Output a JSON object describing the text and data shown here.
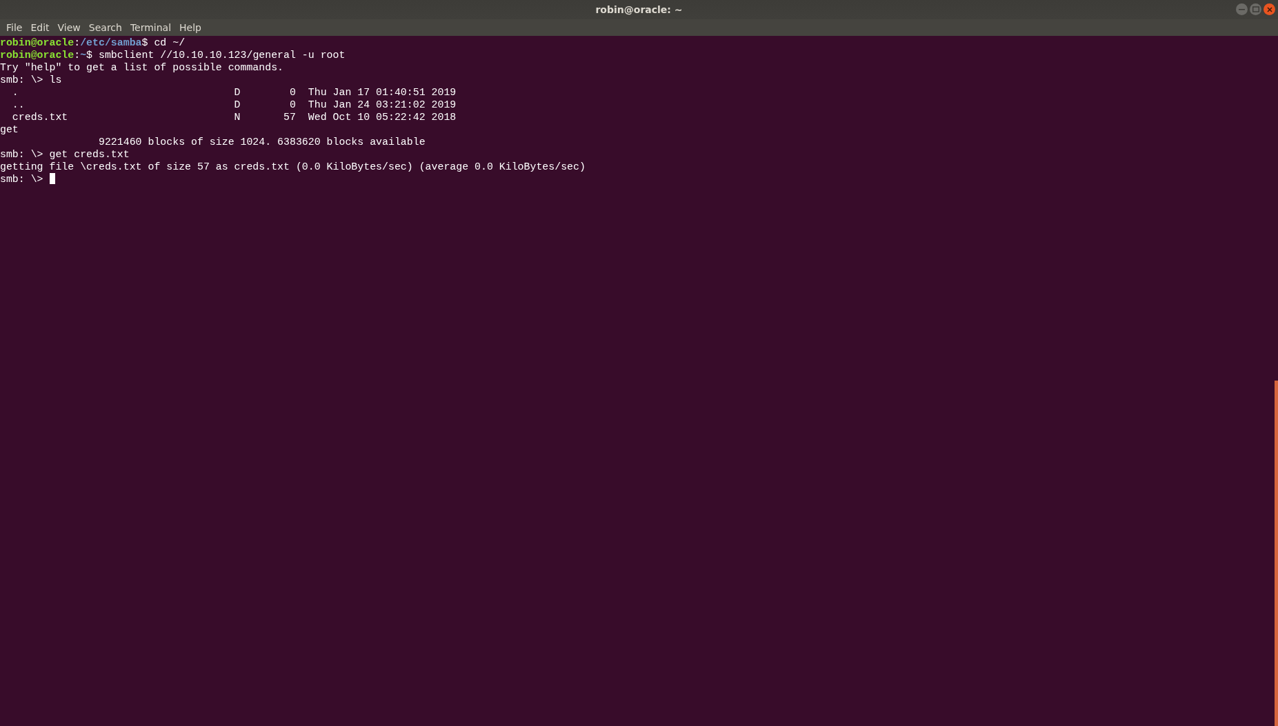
{
  "window": {
    "title": "robin@oracle: ~"
  },
  "menu": [
    "File",
    "Edit",
    "View",
    "Search",
    "Terminal",
    "Help"
  ],
  "lines": [
    {
      "kind": "prompt",
      "user_host": "robin@oracle",
      "separator": ":",
      "path": "/etc/samba",
      "symbol": "$",
      "command": " cd ~/"
    },
    {
      "kind": "prompt",
      "user_host": "robin@oracle",
      "separator": ":",
      "path": "~",
      "symbol": "$",
      "command": " smbclient //10.10.10.123/general -u root"
    },
    {
      "kind": "output",
      "text": "Try \"help\" to get a list of possible commands."
    },
    {
      "kind": "output",
      "text": "smb: \\> ls"
    },
    {
      "kind": "output",
      "text": "  .                                   D        0  Thu Jan 17 01:40:51 2019"
    },
    {
      "kind": "output",
      "text": "  ..                                  D        0  Thu Jan 24 03:21:02 2019"
    },
    {
      "kind": "output",
      "text": "  creds.txt                           N       57  Wed Oct 10 05:22:42 2018"
    },
    {
      "kind": "output",
      "text": "get"
    },
    {
      "kind": "output",
      "text": "                9221460 blocks of size 1024. 6383620 blocks available"
    },
    {
      "kind": "output",
      "text": "smb: \\> get creds.txt"
    },
    {
      "kind": "output",
      "text": "getting file \\creds.txt of size 57 as creds.txt (0.0 KiloBytes/sec) (average 0.0 KiloBytes/sec)"
    },
    {
      "kind": "input",
      "text": "smb: \\> "
    }
  ]
}
